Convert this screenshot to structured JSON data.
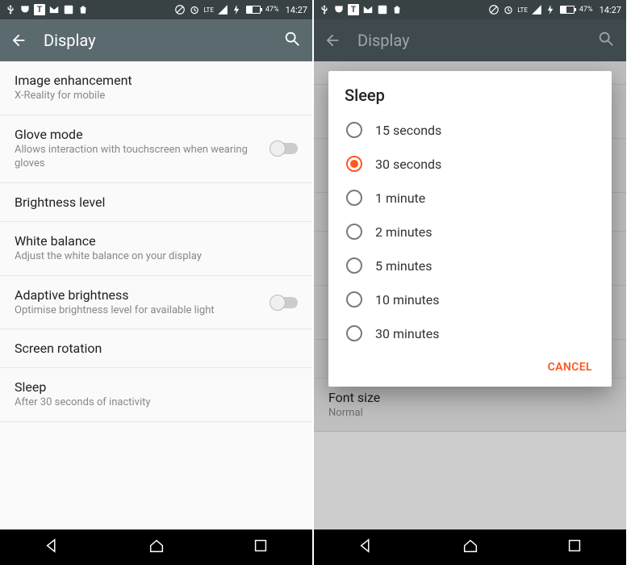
{
  "statusbar": {
    "lte": "LTE",
    "battery_pct": "47%",
    "time": "14:27"
  },
  "appbar": {
    "title": "Display"
  },
  "left": {
    "rows": [
      {
        "title": "Image enhancement",
        "subtitle": "X-Reality for mobile",
        "toggle": false
      },
      {
        "title": "Glove mode",
        "subtitle": "Allows interaction with touchscreen when wearing gloves",
        "toggle": true
      },
      {
        "title": "Brightness level",
        "subtitle": "",
        "toggle": false
      },
      {
        "title": "White balance",
        "subtitle": "Adjust the white balance on your display",
        "toggle": false
      },
      {
        "title": "Adaptive brightness",
        "subtitle": "Optimise brightness level for available light",
        "toggle": true
      },
      {
        "title": "Screen rotation",
        "subtitle": "",
        "toggle": false
      },
      {
        "title": "Sleep",
        "subtitle": "After 30 seconds of inactivity",
        "toggle": false
      }
    ]
  },
  "right_bg": {
    "rows": [
      {
        "title": "",
        "subtitle": ""
      },
      {
        "title": "W",
        "subtitle": "A"
      },
      {
        "title": "A",
        "subtitle": "O"
      },
      {
        "title": "S",
        "subtitle": ""
      },
      {
        "title": "S",
        "subtitle": "A"
      },
      {
        "title": "S",
        "subtitle": "O"
      },
      {
        "title": "D",
        "subtitle": ""
      },
      {
        "title": "Font size",
        "subtitle": "Normal"
      }
    ]
  },
  "dialog": {
    "title": "Sleep",
    "options": [
      {
        "label": "15 seconds",
        "selected": false
      },
      {
        "label": "30 seconds",
        "selected": true
      },
      {
        "label": "1 minute",
        "selected": false
      },
      {
        "label": "2 minutes",
        "selected": false
      },
      {
        "label": "5 minutes",
        "selected": false
      },
      {
        "label": "10 minutes",
        "selected": false
      },
      {
        "label": "30 minutes",
        "selected": false
      }
    ],
    "cancel": "CANCEL"
  },
  "colors": {
    "accent": "#ff5722",
    "appbar": "#5b6a6f"
  }
}
